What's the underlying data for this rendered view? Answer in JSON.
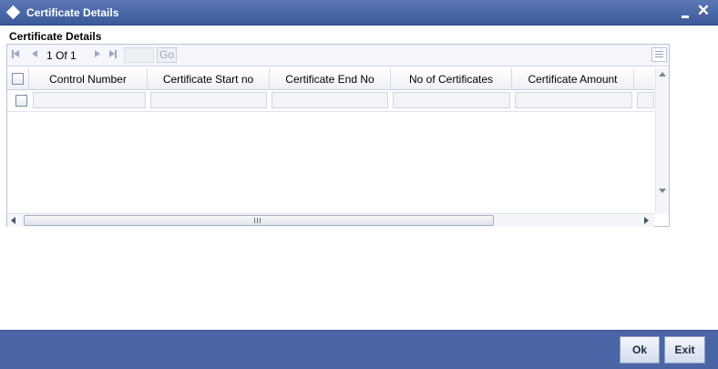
{
  "window": {
    "title": "Certificate Details",
    "close_glyph": "✕"
  },
  "section": {
    "title": "Certificate Details"
  },
  "pager": {
    "current": "1",
    "of_label": "Of",
    "total": "1",
    "go_label": "Go"
  },
  "table": {
    "columns": [
      "Control Number",
      "Certificate Start no",
      "Certificate End No",
      "No of Certificates",
      "Certificate Amount"
    ]
  },
  "scrollbar": {
    "grip": "III"
  },
  "footer": {
    "ok_label": "Ok",
    "exit_label": "Exit"
  },
  "icons": {
    "window": "diamond-icon",
    "minimize": "minimize-icon",
    "close": "close-icon",
    "first": "first-page-icon",
    "prev": "previous-page-icon",
    "next": "next-page-icon",
    "last": "last-page-icon",
    "grid_menu": "grid-menu-icon"
  },
  "colors": {
    "titlebar": "#3c5a9a",
    "footer": "#4b66a6"
  }
}
